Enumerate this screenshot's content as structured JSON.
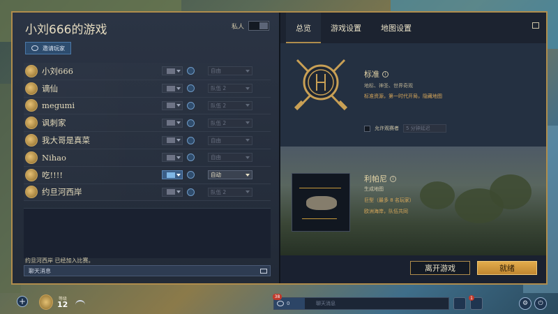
{
  "left": {
    "title": "小刘666的游戏",
    "private_label": "私人",
    "invite_label": "邀请玩家",
    "players": [
      {
        "name": "小刘666",
        "team": "自由",
        "active": false
      },
      {
        "name": "谪仙",
        "team": "队伍 2",
        "active": false
      },
      {
        "name": "megumi",
        "team": "队伍 2",
        "active": false
      },
      {
        "name": "讽刺家",
        "team": "队伍 2",
        "active": false
      },
      {
        "name": "我大哥是真菜",
        "team": "自由",
        "active": false
      },
      {
        "name": "Nihao",
        "team": "自由",
        "active": false
      },
      {
        "name": "吃!!!!",
        "team": "自动",
        "active": true
      },
      {
        "name": "约旦河西岸",
        "team": "队伍 2",
        "active": false
      }
    ],
    "system_message": "约旦河西岸 已经加入比赛。",
    "chat_placeholder": "聊天消息"
  },
  "tabs": [
    {
      "label": "总览",
      "active": true
    },
    {
      "label": "游戏设置",
      "active": false
    },
    {
      "label": "地图设置",
      "active": false
    }
  ],
  "mode": {
    "title": "标准",
    "subtitle": "地标、神圣、世界奇观",
    "description": "标准资源，第一时代开局，隐藏地图",
    "spectator_label": "允许观赛者",
    "spectator_value": "5 分钟延迟"
  },
  "map": {
    "title": "利帕尼",
    "subtitle": "生成地图",
    "size": "巨型（最多 8 名玩家）",
    "team": "欧洲海岸，队伍共同"
  },
  "actions": {
    "leave_label": "离开游戏",
    "ready_label": "就绪"
  },
  "bottom": {
    "level_label": "等级",
    "level": "12",
    "friends_badge": "38",
    "friends_count": "0",
    "chat_placeholder": "聊天消息",
    "notif_badge": "1"
  },
  "colors": {
    "accent_gold": "#b08d4c",
    "ready_button": "#e2ac4c",
    "panel_bg": "#1e2633"
  }
}
